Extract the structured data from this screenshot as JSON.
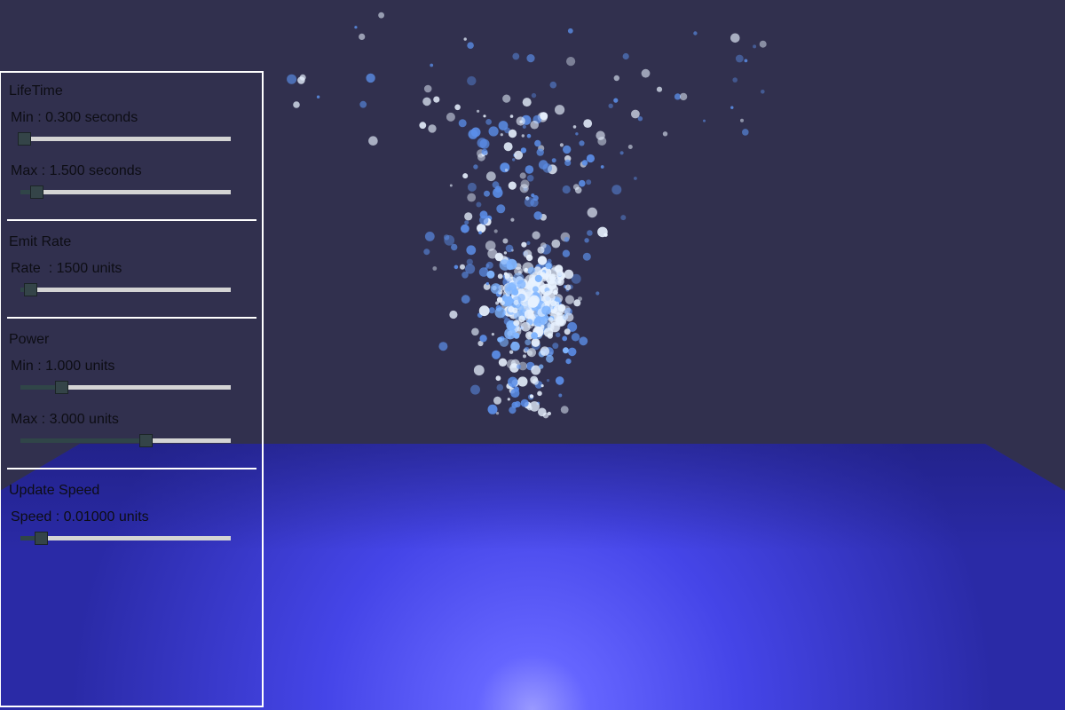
{
  "panel": {
    "sections": [
      {
        "title": "LifeTime",
        "params": [
          {
            "label": "Min : 0.300 seconds",
            "fraction": 0.02
          },
          {
            "label": "Max : 1.500 seconds",
            "fraction": 0.08
          }
        ]
      },
      {
        "title": "Emit Rate",
        "params": [
          {
            "label": "Rate  : 1500 units",
            "fraction": 0.05
          }
        ]
      },
      {
        "title": "Power",
        "params": [
          {
            "label": "Min : 1.000 units",
            "fraction": 0.2
          },
          {
            "label": "Max : 3.000 units",
            "fraction": 0.6
          }
        ]
      },
      {
        "title": "Update Speed",
        "params": [
          {
            "label": "Speed : 0.01000 units",
            "fraction": 0.1
          }
        ]
      }
    ]
  },
  "colors": {
    "background": "#31304e",
    "floor": "#3b3bd8",
    "floor_glow": "#6f6fff",
    "particle_light": "#e8f2ff",
    "particle_blue": "#5b8ee8"
  },
  "icons": {
    "slider_thumb": "square-thumb"
  }
}
